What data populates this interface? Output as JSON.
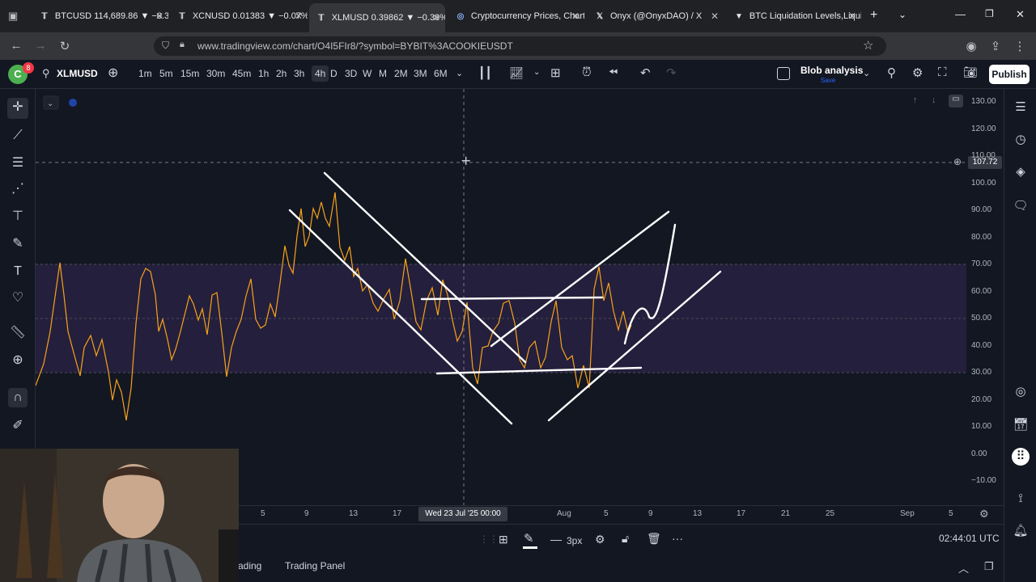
{
  "browser": {
    "tabs": [
      {
        "title": "BTCUSD 114,689.86 ▼ −0.3"
      },
      {
        "title": "XCNUSD 0.01383 ▼ −0.07%"
      },
      {
        "title": "XLMUSD 0.39862 ▼ −0.39%"
      },
      {
        "title": "Cryptocurrency Prices, Chart"
      },
      {
        "title": "Onyx (@OnyxDAO) / X"
      },
      {
        "title": "BTC Liquidation Levels,Liqui"
      }
    ],
    "url": "www.tradingview.com/chart/O4I5FIr8/?symbol=BYBIT%3ACOOKIEUSDT"
  },
  "toolbar": {
    "symbol": "XLMUSD",
    "avatar_letter": "C",
    "notif_count": "8",
    "timeframes": [
      "1m",
      "5m",
      "15m",
      "30m",
      "45m",
      "1h",
      "2h",
      "3h",
      "4h",
      "D",
      "3D",
      "W",
      "M",
      "2M",
      "3M",
      "6M"
    ],
    "selected_timeframe": "4h",
    "layout_name": "Blob analysis",
    "layout_status": "Save",
    "publish": "Publish"
  },
  "chart": {
    "price_labels": [
      "130.00",
      "120.00",
      "110.00",
      "100.00",
      "90.00",
      "80.00",
      "70.00",
      "60.00",
      "50.00",
      "40.00",
      "30.00",
      "20.00",
      "10.00",
      "0.00",
      "−10.00"
    ],
    "crosshair_price": "107.72",
    "crosshair_time": "Wed 23 Jul '25   00:00",
    "time_labels": [
      "5",
      "9",
      "13",
      "17",
      "Aug",
      "5",
      "9",
      "13",
      "17",
      "21",
      "25",
      "Sep",
      "5"
    ],
    "line_color": "#f7a21b"
  },
  "bottom": {
    "clock": "02:44:01 UTC",
    "tabs": [
      "rading",
      "Trading Panel"
    ],
    "stroke_width": "3px"
  }
}
